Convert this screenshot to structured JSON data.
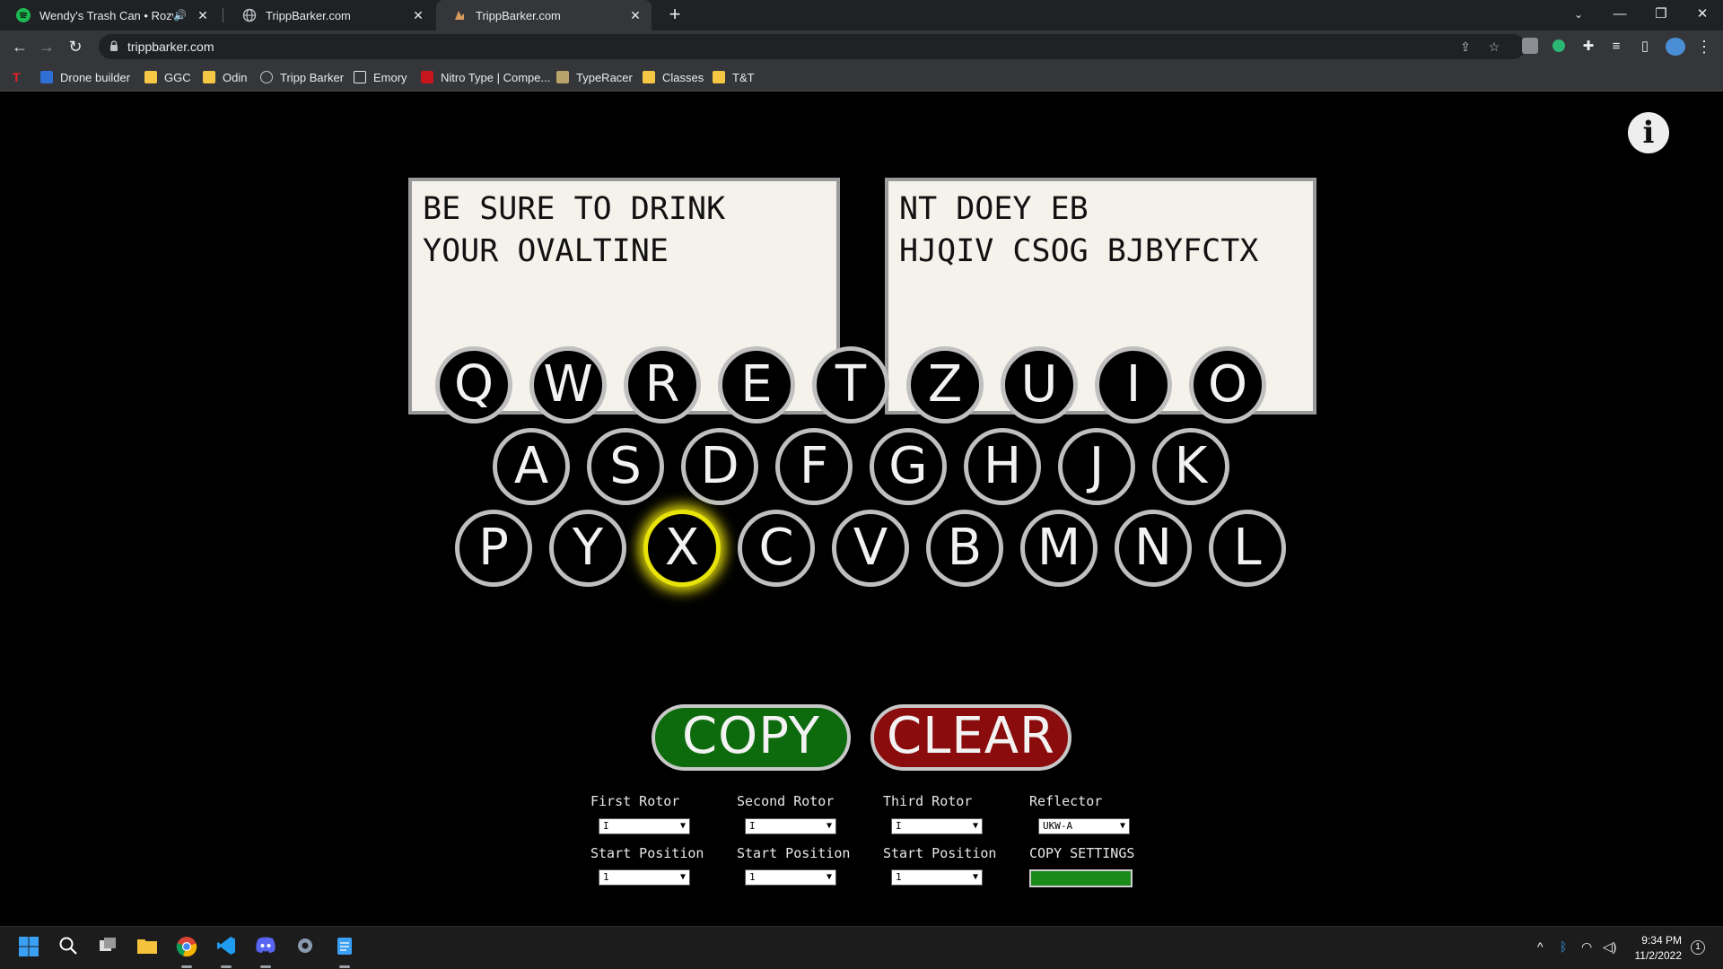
{
  "browser": {
    "tabs": [
      {
        "title": "Wendy's Trash Can • Rozwell",
        "audio_icon": "speaker-icon"
      },
      {
        "title": "TrippBarker.com"
      },
      {
        "title": "TrippBarker.com"
      }
    ],
    "url": "trippbarker.com",
    "bookmarks": [
      "Drone builder",
      "GGC",
      "Odin",
      "Tripp Barker",
      "Emory",
      "Nitro Type | Compe...",
      "TypeRacer",
      "Classes",
      "T&T"
    ]
  },
  "enigma": {
    "info_label": "i",
    "input_text": "BE SURE TO DRINK YOUR OVALTINE",
    "output_text": "NT DOEY EB HJQIV CSOG BJBYFCTX",
    "lampboard": {
      "row1": [
        "Q",
        "W",
        "R",
        "E",
        "T",
        "Z",
        "U",
        "I",
        "O"
      ],
      "row2": [
        "A",
        "S",
        "D",
        "F",
        "G",
        "H",
        "J",
        "K"
      ],
      "row3": [
        "P",
        "Y",
        "X",
        "C",
        "V",
        "B",
        "M",
        "N",
        "L"
      ],
      "lit": "X"
    },
    "copy_label": "COPY",
    "clear_label": "CLEAR",
    "settings": {
      "first_rotor": {
        "label": "First Rotor",
        "value": "I"
      },
      "second_rotor": {
        "label": "Second Rotor",
        "value": "I"
      },
      "third_rotor": {
        "label": "Third Rotor",
        "value": "I"
      },
      "reflector": {
        "label": "Reflector",
        "value": "UKW-A"
      },
      "start_label": "Start Position",
      "first_start": "1",
      "second_start": "1",
      "third_start": "1",
      "copy_settings_label": "COPY SETTINGS"
    }
  },
  "taskbar": {
    "time": "9:34 PM",
    "date": "11/2/2022",
    "notification_count": "1"
  },
  "colors": {
    "copy": "#0d6b0d",
    "clear": "#8a0c0c",
    "lit_key": "#e8e40a"
  }
}
